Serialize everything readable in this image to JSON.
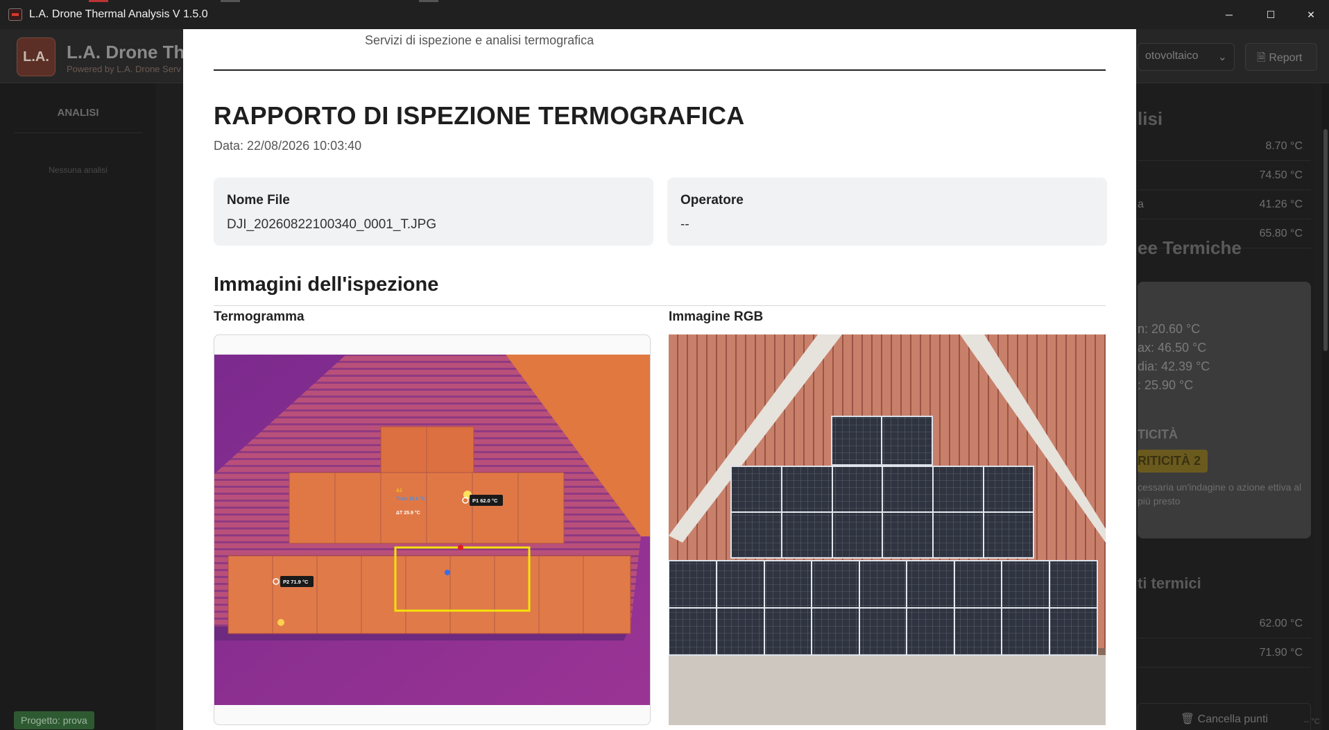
{
  "window": {
    "title": "L.A. Drone Thermal Analysis V 1.5.0",
    "controls": {
      "minimize": "─",
      "maximize": "☐",
      "close": "✕"
    }
  },
  "background_app": {
    "logo_text": "L.A.",
    "title": "L.A. Drone The",
    "powered_by": "Powered by L.A. Drone Serv",
    "select_value": "otovoltaico",
    "report_button": "Report",
    "sidebar_heading": "ANALISI",
    "sidebar_empty": "Nessuna analisi",
    "project_badge": "Progetto: prova",
    "right_heading": "lisi",
    "right_rows": [
      {
        "label": "",
        "value": "8.70 °C"
      },
      {
        "label": "",
        "value": "74.50 °C"
      },
      {
        "label": "a",
        "value": "41.26 °C"
      },
      {
        "label": "",
        "value": "65.80 °C"
      }
    ],
    "anomalies_heading": "ee Termiche",
    "card_stats": [
      "n: 20.60 °C",
      "ax: 46.50 °C",
      "dia: 42.39 °C",
      ": 25.90 °C"
    ],
    "criticality_label": "TICITÀ",
    "criticality_badge": "RITICITÀ 2",
    "criticality_note": "cessaria un'indagine o azione ettiva al più presto",
    "points_heading": "ti termici",
    "point_rows": [
      {
        "value": "62.00 °C"
      },
      {
        "value": "71.90 °C"
      }
    ],
    "delete_button": "Cancella punti",
    "corner_text": "-- °C"
  },
  "report": {
    "subtitle": "Servizi di ispezione e analisi termografica",
    "title": "RAPPORTO DI ISPEZIONE TERMOGRAFICA",
    "date": "Data: 22/08/2026 10:03:40",
    "file_label": "Nome File",
    "file_value": "DJI_20260822100340_0001_T.JPG",
    "operator_label": "Operatore",
    "operator_value": "--",
    "images_heading": "Immagini dell'ispezione",
    "thermal_label": "Termogramma",
    "rgb_label": "Immagine RGB",
    "thermal_annotations": {
      "area_name": "A1",
      "area_line": "Tmin 20.6 °C",
      "area_delta": "ΔT 25.9 °C",
      "p1": "P1  62.0 °C",
      "p2": "P2  71.9 °C"
    }
  },
  "colors": {
    "thermal_bg": "#8a2e93",
    "thermal_panel": "#e0703a",
    "thermal_roof": "#c55a5f",
    "roi": "#f2e20a",
    "rgb_roof": "#c47762",
    "rgb_panel": "#2e3340",
    "badge_green": "#2e5a32"
  }
}
